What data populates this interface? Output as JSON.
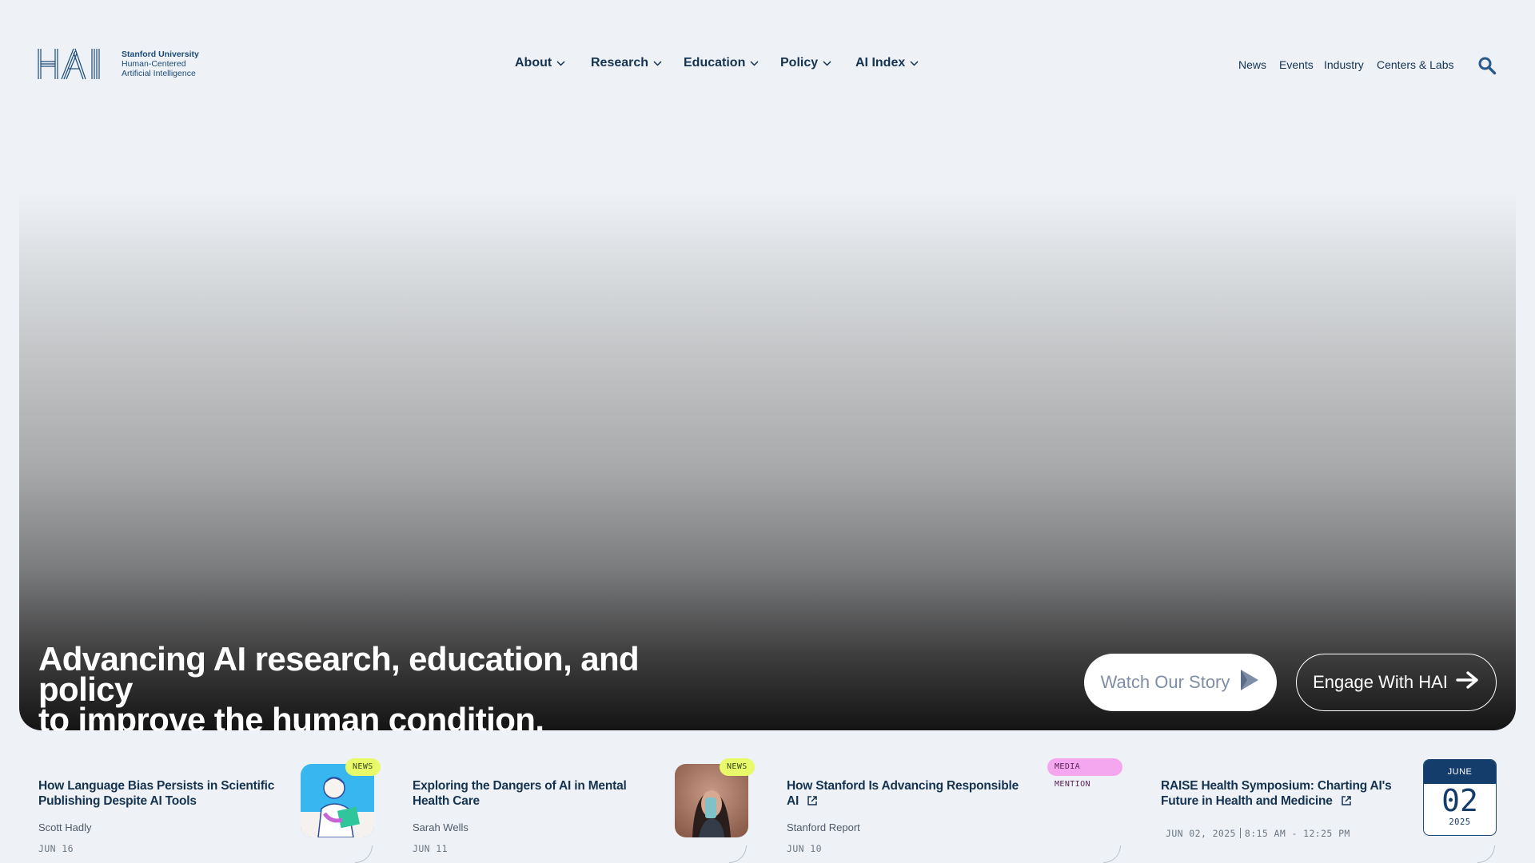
{
  "logo": {
    "letters": "HAI",
    "line1": "Stanford University",
    "line2": "Human-Centered",
    "line3": "Artificial Intelligence"
  },
  "main_nav": [
    {
      "label": "About"
    },
    {
      "label": "Research"
    },
    {
      "label": "Education"
    },
    {
      "label": "Policy"
    },
    {
      "label": "AI Index"
    }
  ],
  "util_nav": [
    {
      "label": "News"
    },
    {
      "label": "Events"
    },
    {
      "label": "Industry"
    },
    {
      "label": "Centers & Labs"
    }
  ],
  "hero": {
    "headline_line1": "Advancing AI research, education, and policy",
    "headline_line2": "to improve the human condition.",
    "watch_label": "Watch Our Story",
    "engage_label": "Engage With HAI"
  },
  "cards": [
    {
      "title_line1": "How Language Bias Persists in Scientific",
      "title_line2": "Publishing Despite AI Tools",
      "author": "Scott Hadly",
      "date": "JUN 16",
      "badge": "NEWS"
    },
    {
      "title_line1": "Exploring the Dangers of AI in Mental",
      "title_line2": "Health Care",
      "author": "Sarah Wells",
      "date": "JUN 11",
      "badge": "NEWS"
    },
    {
      "title_line1": "How Stanford Is Advancing Responsible",
      "title_line2": "AI",
      "author": "Stanford Report",
      "date": "JUN 10",
      "badge": "MEDIA MENTION"
    },
    {
      "title_line1": "RAISE Health Symposium: Charting AI's",
      "title_line2": "Future in Health and Medicine",
      "event_date": "JUN 02, 2025",
      "event_time": "8:15 AM - 12:25 PM",
      "cal_month": "JUNE",
      "cal_day": "02",
      "cal_year": "2025"
    }
  ],
  "colors": {
    "page_bg": "#eef2f6",
    "navy": "#153350",
    "news_badge": "#e8f96a",
    "media_badge": "#f4a6ee"
  },
  "icons": [
    "chevron-down-icon",
    "search-icon",
    "play-icon",
    "arrow-right-icon",
    "external-link-icon"
  ]
}
